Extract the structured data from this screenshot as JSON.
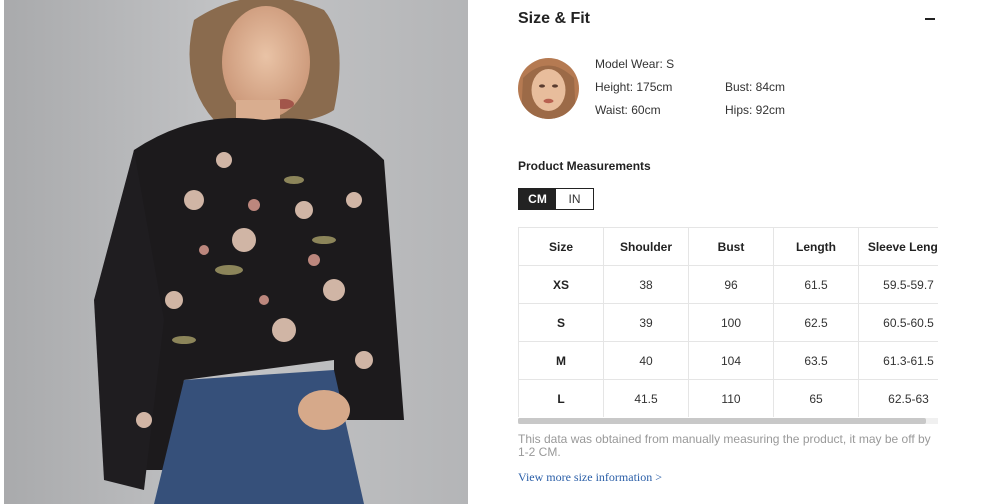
{
  "section": {
    "title": "Size & Fit",
    "collapse_icon": "minus-icon"
  },
  "model": {
    "wear": "Model Wear: S",
    "height": "Height: 175cm",
    "bust": "Bust: 84cm",
    "waist": "Waist: 60cm",
    "hips": "Hips: 92cm"
  },
  "measurements": {
    "title": "Product Measurements",
    "units": [
      "CM",
      "IN"
    ],
    "selected_unit": "CM",
    "headers": [
      "Size",
      "Shoulder",
      "Bust",
      "Length",
      "Sleeve Length"
    ],
    "rows": [
      [
        "XS",
        "38",
        "96",
        "61.5",
        "59.5-59.7"
      ],
      [
        "S",
        "39",
        "100",
        "62.5",
        "60.5-60.5"
      ],
      [
        "M",
        "40",
        "104",
        "63.5",
        "61.3-61.5"
      ],
      [
        "L",
        "41.5",
        "110",
        "65",
        "62.5-63"
      ]
    ]
  },
  "note": "This data was obtained from manually measuring the product, it may be off by 1-2 CM.",
  "more_link": "View more size information >",
  "colors": {
    "accent": "#222222",
    "link": "#2b5fa8",
    "muted": "#999999",
    "border": "#e5e5e5"
  }
}
